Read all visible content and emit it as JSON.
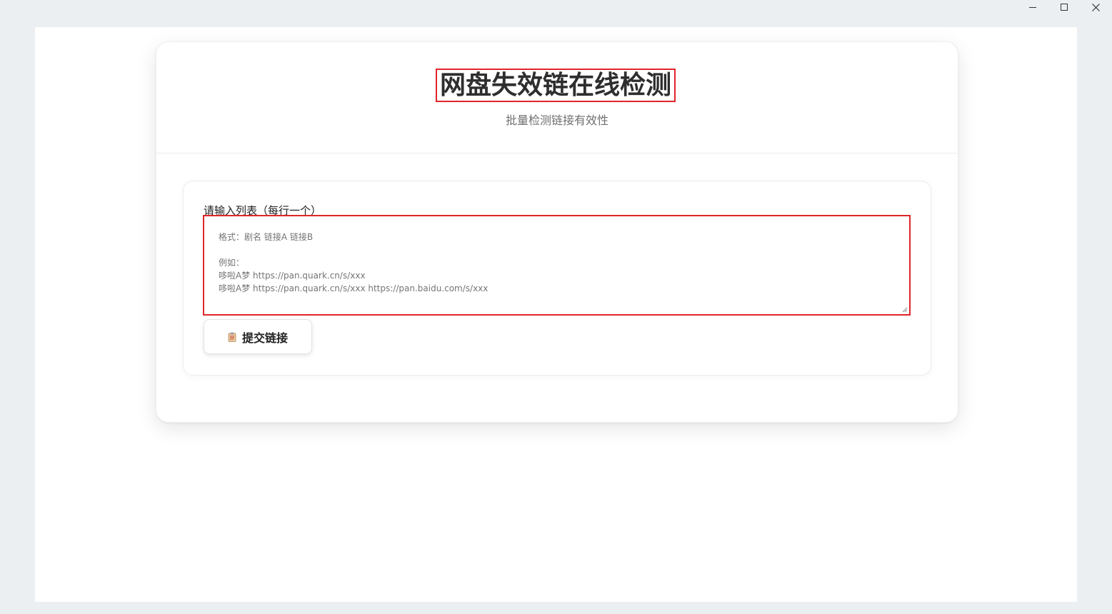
{
  "window": {
    "controls": [
      "minimize",
      "maximize",
      "close"
    ]
  },
  "header": {
    "title": "网盘失效链在线检测",
    "subtitle": "批量检测链接有效性"
  },
  "form": {
    "label": "请输入列表（每行一个）",
    "placeholder": "格式：剧名 链接A 链接B\n\n例如：\n哆啦A梦 https://pan.quark.cn/s/xxx\n哆啦A梦 https://pan.quark.cn/s/xxx https://pan.baidu.com/s/xxx",
    "submit_label": "提交链接",
    "submit_icon": "clipboard-icon"
  },
  "colors": {
    "highlight": "#e0252b",
    "title": "#2e2e2e",
    "subtitle": "#6f6f6f",
    "background": "#eceff2"
  }
}
